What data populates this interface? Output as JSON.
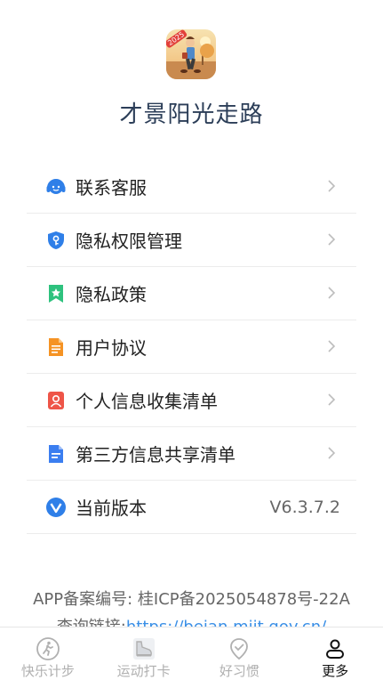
{
  "app": {
    "name": "才景阳光走路",
    "logo_badge": "2025"
  },
  "menu": [
    {
      "id": "customer-service",
      "label": "联系客服",
      "icon": "headset-icon",
      "color": "#2f7fe8"
    },
    {
      "id": "privacy-permissions",
      "label": "隐私权限管理",
      "icon": "shield-key-icon",
      "color": "#2f7fe8"
    },
    {
      "id": "privacy-policy",
      "label": "隐私政策",
      "icon": "bookmark-star-icon",
      "color": "#2ec27e"
    },
    {
      "id": "user-agreement",
      "label": "用户协议",
      "icon": "document-icon",
      "color": "#f59324"
    },
    {
      "id": "personal-info",
      "label": "个人信息收集清单",
      "icon": "person-card-icon",
      "color": "#ee5548"
    },
    {
      "id": "third-party",
      "label": "第三方信息共享清单",
      "icon": "doc-list-icon",
      "color": "#3b7ef0"
    },
    {
      "id": "version",
      "label": "当前版本",
      "icon": "v-circle-icon",
      "color": "#2f7fe8",
      "value": "V6.3.7.2"
    }
  ],
  "footer": {
    "icp_label": "APP备案编号: 桂ICP备2025054878号-22A",
    "query_label": "查询链接:",
    "query_link": "https://beian.miit.gov.cn/"
  },
  "bottom_nav": [
    {
      "label": "快乐计步",
      "icon": "walker-icon",
      "active": false
    },
    {
      "label": "运动打卡",
      "icon": "sneaker-icon",
      "active": false
    },
    {
      "label": "好习惯",
      "icon": "check-pin-icon",
      "active": false
    },
    {
      "label": "更多",
      "icon": "person-icon",
      "active": true
    }
  ]
}
